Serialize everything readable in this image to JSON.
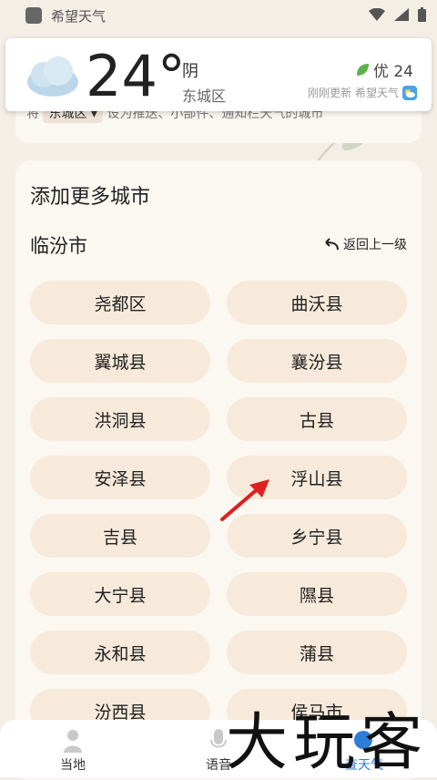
{
  "statusbar": {
    "app_name": "希望天气"
  },
  "weather": {
    "temperature": "24°",
    "condition": "阴",
    "district": "东城区",
    "aqi_label": "优 24",
    "updated": "刚刚更新 希望天气"
  },
  "peek_card": {
    "prefix": "将",
    "pill": "东城区 ▾",
    "suffix": " 设为推送、小部件、通知栏天气的城市"
  },
  "main": {
    "title": "添加更多城市",
    "city": "临汾市",
    "back_label": "返回上一级",
    "counties": [
      "尧都区",
      "曲沃县",
      "翼城县",
      "襄汾县",
      "洪洞县",
      "古县",
      "安泽县",
      "浮山县",
      "吉县",
      "乡宁县",
      "大宁县",
      "隰县",
      "永和县",
      "蒲县",
      "汾西县",
      "侯马市"
    ]
  },
  "nav": {
    "items": [
      "当地",
      "语音",
      "查天气"
    ]
  },
  "watermark": "大玩客",
  "colors": {
    "accent": "#2e7dd6",
    "pill_bg": "#f7eadb",
    "arrow": "#e02020",
    "leaf": "#5db24a"
  }
}
